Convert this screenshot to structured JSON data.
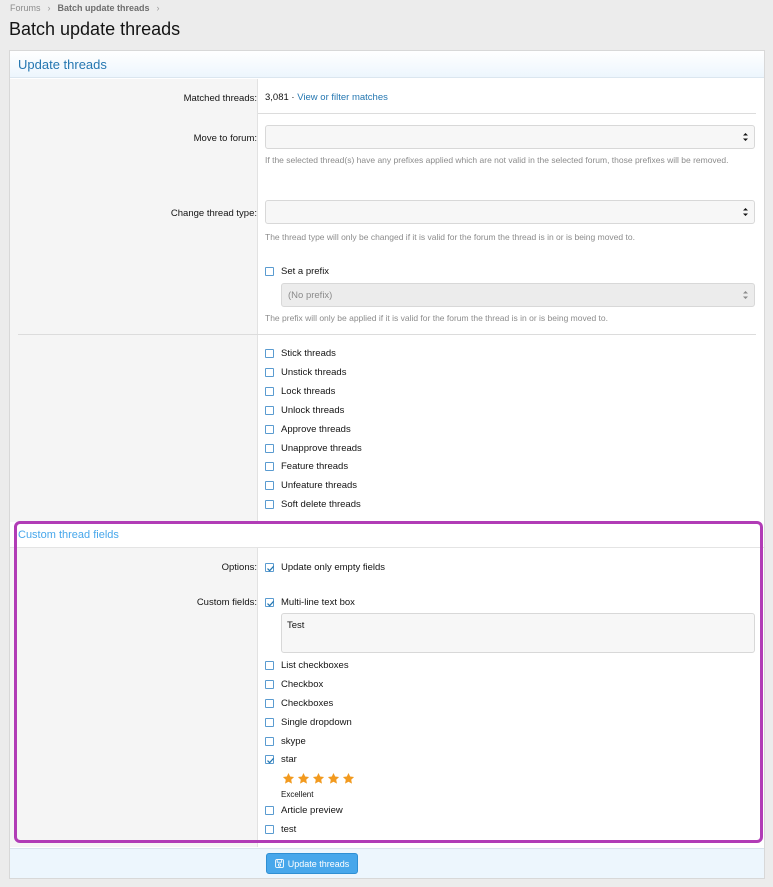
{
  "breadcrumb": {
    "items": [
      "Forums",
      "Batch update threads"
    ]
  },
  "page": {
    "title": "Batch update threads"
  },
  "block": {
    "title": "Update threads"
  },
  "matched": {
    "label": "Matched threads:",
    "count": "3,081",
    "separator": " · ",
    "link": "View or filter matches"
  },
  "move_forum": {
    "label": "Move to forum:",
    "value": "",
    "hint": "If the selected thread(s) have any prefixes applied which are not valid in the selected forum, those prefixes will be removed."
  },
  "thread_type": {
    "label": "Change thread type:",
    "value": "",
    "hint": "The thread type will only be changed if it is valid for the forum the thread is in or is being moved to."
  },
  "prefix": {
    "label": "Set a prefix",
    "checked": false,
    "select_value": "(No prefix)",
    "hint": "The prefix will only be applied if it is valid for the forum the thread is in or is being moved to."
  },
  "actions": [
    {
      "label": "Stick threads",
      "checked": false
    },
    {
      "label": "Unstick threads",
      "checked": false
    },
    {
      "label": "Lock threads",
      "checked": false
    },
    {
      "label": "Unlock threads",
      "checked": false
    },
    {
      "label": "Approve threads",
      "checked": false
    },
    {
      "label": "Unapprove threads",
      "checked": false
    },
    {
      "label": "Feature threads",
      "checked": false
    },
    {
      "label": "Unfeature threads",
      "checked": false
    },
    {
      "label": "Soft delete threads",
      "checked": false
    }
  ],
  "custom": {
    "title": "Custom thread fields",
    "options_label": "Options:",
    "options": {
      "label": "Update only empty fields",
      "checked": true
    },
    "fields_label": "Custom fields:",
    "multiline": {
      "label": "Multi-line text box",
      "checked": true,
      "value": "Test"
    },
    "fields_a": [
      {
        "label": "List checkboxes",
        "checked": false
      },
      {
        "label": "Checkbox",
        "checked": false
      },
      {
        "label": "Checkboxes",
        "checked": false
      },
      {
        "label": "Single dropdown",
        "checked": false
      },
      {
        "label": "skype",
        "checked": false
      }
    ],
    "star": {
      "label": "star",
      "checked": true,
      "rating": 5,
      "max": 5,
      "caption": "Excellent"
    },
    "fields_b": [
      {
        "label": "Article preview",
        "checked": false
      },
      {
        "label": "test",
        "checked": false
      }
    ]
  },
  "footer": {
    "button_label": "Update threads"
  },
  "colors": {
    "accent": "#2577b1",
    "button": "#47a7eb",
    "star": "#f29a1f",
    "highlight": "#b13cb6"
  },
  "icons": {
    "breadcrumb_sep": "chevron-right-icon",
    "select_caret": "updown-caret-icon",
    "check": "check-icon",
    "star": "star-icon",
    "save": "save-icon"
  }
}
